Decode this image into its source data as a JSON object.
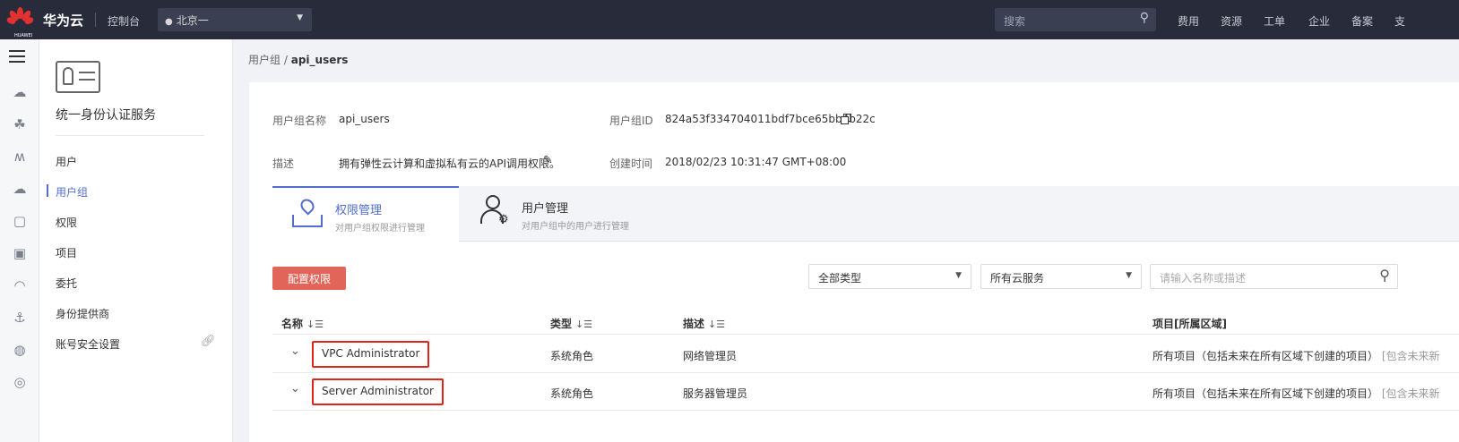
{
  "topbar": {
    "logo_text": "HUAWEI",
    "brand": "华为云",
    "console": "控制台",
    "region": "北京一",
    "search_placeholder": "搜索",
    "nav": [
      "费用",
      "资源",
      "工单",
      "企业",
      "备案",
      "支"
    ]
  },
  "sidebar": {
    "title": "统一身份认证服务",
    "items": [
      {
        "label": "用户",
        "active": false
      },
      {
        "label": "用户组",
        "active": true
      },
      {
        "label": "权限",
        "active": false
      },
      {
        "label": "项目",
        "active": false
      },
      {
        "label": "委托",
        "active": false
      },
      {
        "label": "身份提供商",
        "active": false
      },
      {
        "label": "账号安全设置",
        "active": false
      }
    ]
  },
  "breadcrumb": {
    "parent": "用户组",
    "separator": "/",
    "current": "api_users"
  },
  "group_info": {
    "name_label": "用户组名称",
    "name_value": "api_users",
    "id_label": "用户组ID",
    "id_value": "824a53f334704011bdf7bce65bb4b22c",
    "desc_label": "描述",
    "desc_value": "拥有弹性云计算和虚拟私有云的API调用权限。",
    "created_label": "创建时间",
    "created_value": "2018/02/23 10:31:47 GMT+08:00"
  },
  "tabs": [
    {
      "title": "权限管理",
      "subtitle": "对用户组权限进行管理",
      "active": true
    },
    {
      "title": "用户管理",
      "subtitle": "对用户组中的用户进行管理",
      "active": false
    }
  ],
  "toolbar": {
    "config_button": "配置权限",
    "type_filter": "全部类型",
    "service_filter": "所有云服务",
    "search_placeholder": "请输入名称或描述"
  },
  "table": {
    "headers": {
      "name": "名称",
      "type": "类型",
      "desc": "描述",
      "project": "项目[所属区域]"
    },
    "rows": [
      {
        "name": "VPC Administrator",
        "type": "系统角色",
        "desc": "网络管理员",
        "project": "所有项目（包括未来在所有区域下创建的项目）",
        "project_extra": "[包含未来新"
      },
      {
        "name": "Server Administrator",
        "type": "系统角色",
        "desc": "服务器管理员",
        "project": "所有项目（包括未来在所有区域下创建的项目）",
        "project_extra": "[包含未来新"
      }
    ]
  },
  "colors": {
    "topbar_bg": "#272b3a",
    "accent": "#526ecc",
    "primary_button": "#e2655a",
    "highlight_box": "#e0251b"
  }
}
